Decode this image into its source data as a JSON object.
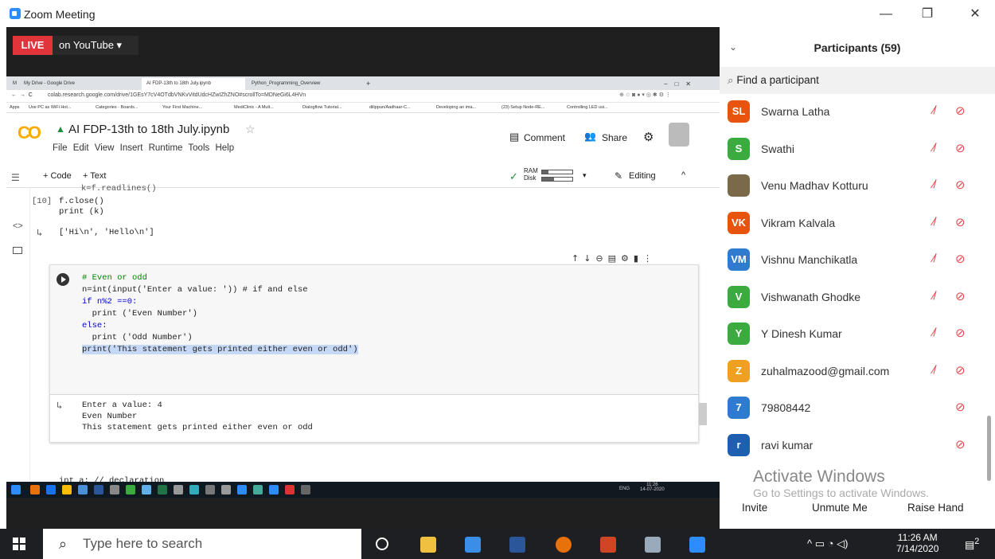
{
  "window": {
    "title": "Zoom Meeting",
    "minimize": "—",
    "maximize": "❐",
    "close": "✕"
  },
  "live": {
    "badge": "LIVE",
    "label": "on YouTube ▾"
  },
  "browser": {
    "tabs": [
      "M",
      "My Drive - Google Drive",
      "AI FDP-13th to 18th July.ipynb",
      "Python_Programming_Overview",
      "+"
    ],
    "url": "colab.research.google.com/drive/1GEsY7cV4OTdbVNKvVitdUdcHZwIZhZNO#scrollTo=MDNeGi6L4HVn",
    "bookmarks": [
      "Apps",
      "Use PC as WiFi Hot...",
      "Categories - Boards...",
      "Your First Machine...",
      "MediClinic - A Mult...",
      "Dialogflow Tutorial...",
      "dilippun/Aadhaar-C...",
      "Developing an ima...",
      "(23) Setup Node-RE...",
      "Controlling LED usi..."
    ]
  },
  "colab": {
    "logo": "CO",
    "notebook_title": "AI FDP-13th to 18th July.ipynb",
    "menu": "File  Edit  View  Insert  Runtime  Tools  Help",
    "comment": "Comment",
    "share": "Share",
    "add_code": "+ Code",
    "add_text": "+ Text",
    "ram": "RAM",
    "disk": "Disk",
    "editing": "Editing",
    "prev_cell": {
      "partial": "k=f.readlines()",
      "prompt": "[10]",
      "lines": [
        "f.close()",
        "print (k)"
      ],
      "output": "['Hi\\n', 'Hello\\n']"
    },
    "code_lines": [
      "# Even or odd",
      "n=int(input('Enter a value: ')) # if and else",
      "if n%2 ==0:",
      "  print ('Even Number')",
      "else:",
      "  print ('Odd Number')",
      "print('This statement gets printed either even or odd')"
    ],
    "output_lines": [
      "Enter a value: 4",
      "Even Number",
      "This statement gets printed either even or odd"
    ],
    "next_cell_partial": "int a; // declaration",
    "inner_clock": {
      "time": "11:26",
      "date": "14-07-2020",
      "lang": "ENG"
    }
  },
  "participants": {
    "title": "Participants (59)",
    "search_placeholder": "Find a participant",
    "list": [
      {
        "initials": "SL",
        "name": "Swarna Latha",
        "color": "#e8540d",
        "mic": "muted"
      },
      {
        "initials": "S",
        "name": "Swathi",
        "color": "#3cab3f",
        "mic": "muted"
      },
      {
        "initials": "",
        "name": "Venu Madhav Kotturu",
        "color": "#7a6a4a",
        "mic": "muted"
      },
      {
        "initials": "VK",
        "name": "Vikram Kalvala",
        "color": "#e8540d",
        "mic": "muted"
      },
      {
        "initials": "VM",
        "name": "Vishnu Manchikatla",
        "color": "#2e7bcf",
        "mic": "muted"
      },
      {
        "initials": "V",
        "name": "Vishwanath Ghodke",
        "color": "#3cab3f",
        "mic": "muted"
      },
      {
        "initials": "Y",
        "name": "Y Dinesh Kumar",
        "color": "#3cab3f",
        "mic": "muted"
      },
      {
        "initials": "Z",
        "name": "zuhalmazood@gmail.com",
        "color": "#f0a020",
        "mic": "muted"
      },
      {
        "initials": "7",
        "name": "79808442",
        "color": "#2e7bcf",
        "mic": "none"
      },
      {
        "initials": "r",
        "name": "ravi kumar",
        "color": "#1f5fb0",
        "mic": "none"
      }
    ],
    "invite": "Invite",
    "unmute": "Unmute Me",
    "raise_hand": "Raise Hand",
    "watermark_title": "Activate Windows",
    "watermark_sub": "Go to Settings to activate Windows."
  },
  "taskbar": {
    "search": "Type here to search",
    "time": "11:26 AM",
    "date": "7/14/2020",
    "notifications": "2"
  }
}
